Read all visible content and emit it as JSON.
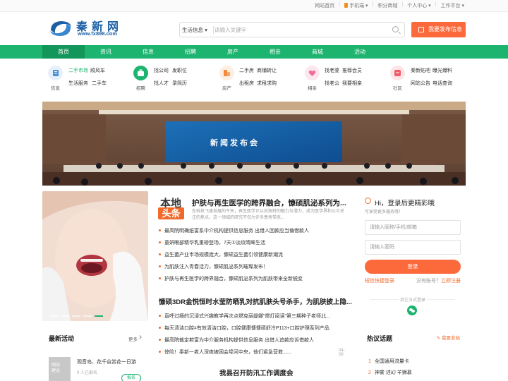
{
  "topbar": {
    "links": [
      "网站首页",
      "手机端",
      "积分商城",
      "个人中心",
      "工作平台"
    ]
  },
  "logo": {
    "name": "秦新网",
    "url": "www.fx898.com"
  },
  "search": {
    "category": "生活信息",
    "placeholder": "请输入关键字"
  },
  "post_button": "我要发布信息",
  "nav": [
    "首页",
    "资讯",
    "信息",
    "招聘",
    "房产",
    "相亲",
    "商城",
    "活动"
  ],
  "categories": [
    {
      "label": "信息",
      "color": "#4a90d9",
      "links": [
        "二手市场",
        "顺风车",
        "生活服务",
        "二手车"
      ]
    },
    {
      "label": "招聘",
      "color": "#1cb46f",
      "links": [
        "找公司",
        "发职位",
        "找人才",
        "录简历"
      ]
    },
    {
      "label": "房产",
      "color": "#f08a3c",
      "links": [
        "二手房",
        "商铺转让",
        "出租房",
        "求租求购"
      ]
    },
    {
      "label": "相亲",
      "color": "#f06d9a",
      "links": [
        "找老婆",
        "推荐会员",
        "找老公",
        "我要相亲"
      ]
    },
    {
      "label": "社区",
      "color": "#f05a6a",
      "links": [
        "秦新贴吧",
        "曝光爆料",
        "网站公告",
        "电话查询"
      ]
    }
  ],
  "banner": {
    "sign": "新闻发布会"
  },
  "headline_badge": {
    "top": "本地",
    "bottom": "头条"
  },
  "headline": {
    "title": "护肤与再生医学的跨界融合，慷硕肌泌系列为...",
    "summary": "在科技飞速发展的今天，再生医学正以其独特的魅力与潜力，成为医学界和公众关注的焦点。这一领域的研究不仅为许多患者带来..."
  },
  "news": [
    "最高院明确纸富系中介机构提供信息服务 出借人回款应当偏借款人",
    "童妍眼部精华乳重磅登场，7天①淡纹晴眸生活",
    "益生菌产业市场规模庞大，慷硕益生菌引领健康新潮流",
    "为肌肤注入青春活力，慷硕肌泌系列璀璨发布！",
    "护肤与再生医学的跨界融合，慷硕肌泌系列为肌肤带来全新蜕变"
  ],
  "headline2": "慷硕3DR金悦恒时水莹防晒乳对抗肌肤头号杀手，为肌肤披上隐...",
  "news2": [
    {
      "text": "直呼过瘾的沉浸式兴趣教学再次点燃克丽缇娜\"燃灯阅读\"第三期种子老师北...",
      "date": ""
    },
    {
      "text": "每天清洁口腔≠有效清洁口腔，口腔健康慷慷硕舒冷P113+口腔护理系列产品",
      "date": ""
    },
    {
      "text": "最高院裁定欺富为中介服务机构提供信息服务 出借人追款应诉借款人",
      "date": ""
    },
    {
      "text": "惊险！奉新一老人深夜被困会埠河中央，他们紧急营救......",
      "date": "04-08"
    }
  ],
  "headline3": "我县召开防汛工作调度会",
  "latest": {
    "title": "最新活动",
    "more": "更多",
    "item": {
      "title": "观音岛、花千谷赏花一日游",
      "sub": "0 人已报名",
      "button": "报名",
      "thumb": "网站\n建设"
    }
  },
  "login": {
    "greeting": "Hi，登录后更精彩哦",
    "hint": "可享受更多服务哦！",
    "user_placeholder": "请输入昵称/手机/邮箱",
    "pass_placeholder": "请输入密码",
    "button": "登录",
    "sms": "短信快捷登录",
    "no_account": "没有账号？",
    "register": "立即注册",
    "other": "其它方式登录"
  },
  "topics": {
    "title": "热议话题",
    "post": "我要发帖",
    "items": [
      "全国通用流量卡",
      "神雾 述幻 羊狮慕"
    ]
  },
  "colors": {
    "brand_green": "#1cb46f",
    "accent_orange": "#fc6a3c",
    "logo_blue": "#1b5fa5"
  }
}
